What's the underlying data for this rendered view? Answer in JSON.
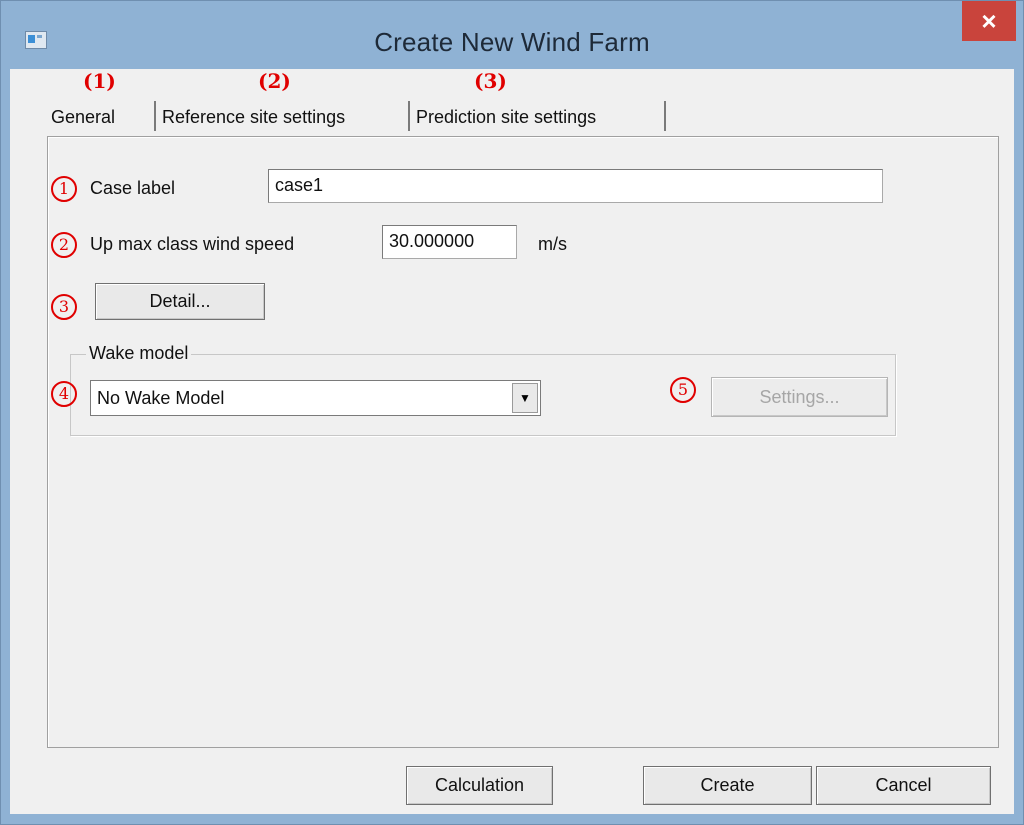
{
  "window": {
    "title": "Create New Wind Farm",
    "close_glyph": "×"
  },
  "annotations": {
    "tab_marks": [
      "(1)",
      "(2)",
      "(3)"
    ],
    "circle_marks": [
      "1",
      "2",
      "3",
      "4",
      "5"
    ]
  },
  "tabs": [
    {
      "label": "General",
      "selected": true
    },
    {
      "label": "Reference site settings",
      "selected": false
    },
    {
      "label": "Prediction site settings",
      "selected": false
    }
  ],
  "general": {
    "case_label": {
      "label": "Case label",
      "value": "case1"
    },
    "max_wind_speed": {
      "label": "Up max class wind speed",
      "value": "30.000000",
      "unit": "m/s"
    },
    "detail_button": "Detail...",
    "wake_model": {
      "group_title": "Wake model",
      "selected": "No Wake Model",
      "settings_button": "Settings...",
      "settings_enabled": false
    }
  },
  "footer": {
    "calculation_button": "Calculation",
    "create_button": "Create",
    "cancel_button": "Cancel"
  },
  "colors": {
    "annotation_red": "#e00000",
    "titlebar_blue": "#8fb2d4",
    "close_red": "#c9443c",
    "dialog_gray": "#f0f0f0"
  }
}
